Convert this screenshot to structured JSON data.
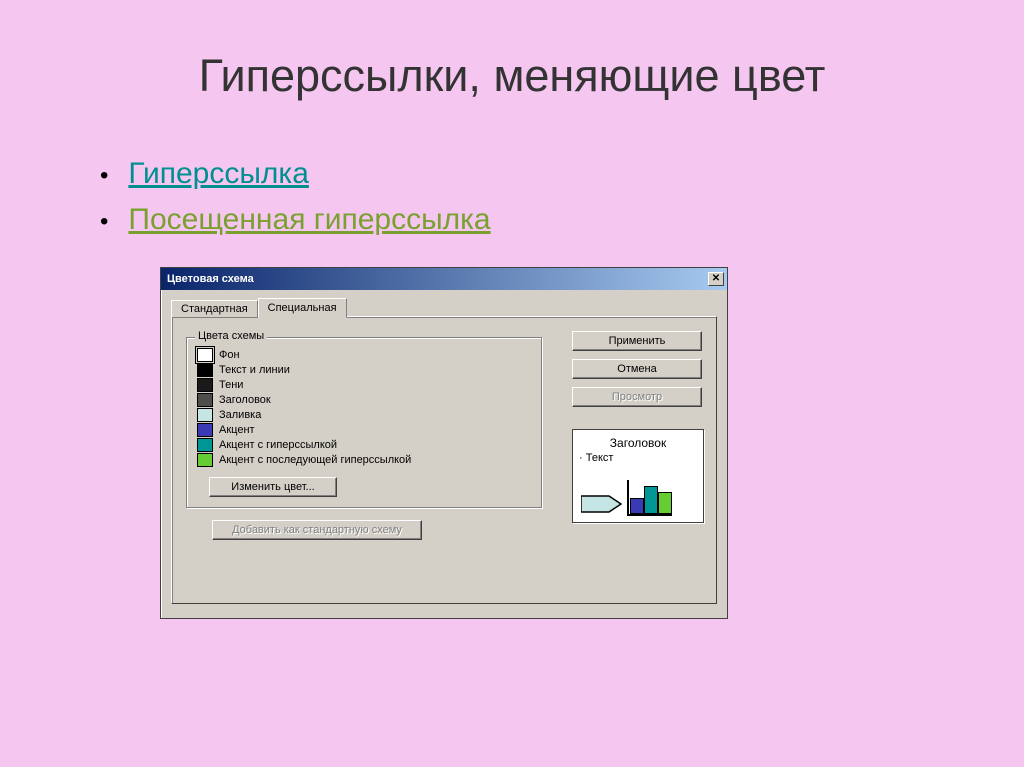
{
  "slide": {
    "title": "Гиперссылки, меняющие цвет",
    "bullets": [
      {
        "text": "Гиперссылка",
        "class": "link1"
      },
      {
        "text": "Посещенная гиперссылка",
        "class": "link2"
      }
    ]
  },
  "dialog": {
    "title": "Цветовая схема",
    "tabs": {
      "standard": "Стандартная",
      "special": "Специальная"
    },
    "groupbox_label": "Цвета схемы",
    "swatches": [
      {
        "label": "Фон",
        "color": "#ffffff",
        "selected": true
      },
      {
        "label": "Текст и линии",
        "color": "#000000"
      },
      {
        "label": "Тени",
        "color": "#1a1a1a"
      },
      {
        "label": "Заголовок",
        "color": "#4d4d4d"
      },
      {
        "label": "Заливка",
        "color": "#c5e5e5"
      },
      {
        "label": "Акцент",
        "color": "#3a3ab5"
      },
      {
        "label": "Акцент с гиперссылкой",
        "color": "#009696"
      },
      {
        "label": "Акцент с последующей гиперссылкой",
        "color": "#66cc33"
      }
    ],
    "buttons": {
      "change_color": "Изменить цвет...",
      "add_standard": "Добавить как стандартную схему",
      "apply": "Применить",
      "cancel": "Отмена",
      "preview": "Просмотр"
    },
    "preview": {
      "title": "Заголовок",
      "bullet": "Текст",
      "bars": [
        {
          "h": 16,
          "c": "#3a3ab5"
        },
        {
          "h": 28,
          "c": "#009696"
        },
        {
          "h": 22,
          "c": "#66cc33"
        }
      ]
    }
  }
}
